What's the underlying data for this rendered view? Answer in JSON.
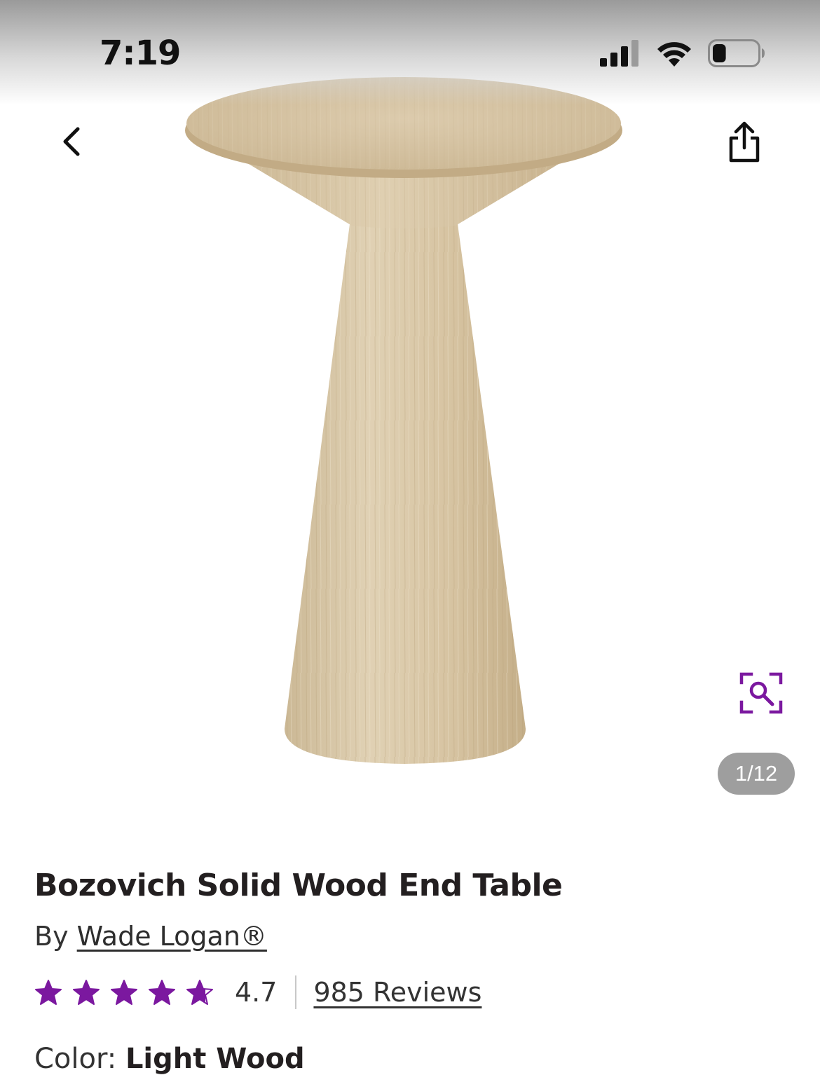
{
  "status_bar": {
    "time": "7:19",
    "icons": [
      "cellular-signal-icon",
      "wifi-icon",
      "battery-icon"
    ],
    "battery_level": 0.3
  },
  "nav": {
    "back_icon": "chevron-left-icon",
    "share_icon": "share-icon"
  },
  "gallery": {
    "image_subject": "conical pedestal end table, light wood",
    "zoom_icon": "visual-search-icon",
    "counter": "1/12"
  },
  "product": {
    "title": "Bozovich Solid Wood End Table",
    "by_prefix": "By",
    "brand": "Wade Logan®",
    "rating": "4.7",
    "rating_value": 4.7,
    "rating_max": 5,
    "reviews_label": "985 Reviews",
    "color_label": "Color:",
    "color_value": "Light Wood"
  },
  "colors": {
    "accent_purple": "#7b189f",
    "counter_bg": "#9e9e9e",
    "text_dark": "#231f20",
    "wood_light": "#dccbad",
    "wood_mid": "#c9b28c"
  }
}
